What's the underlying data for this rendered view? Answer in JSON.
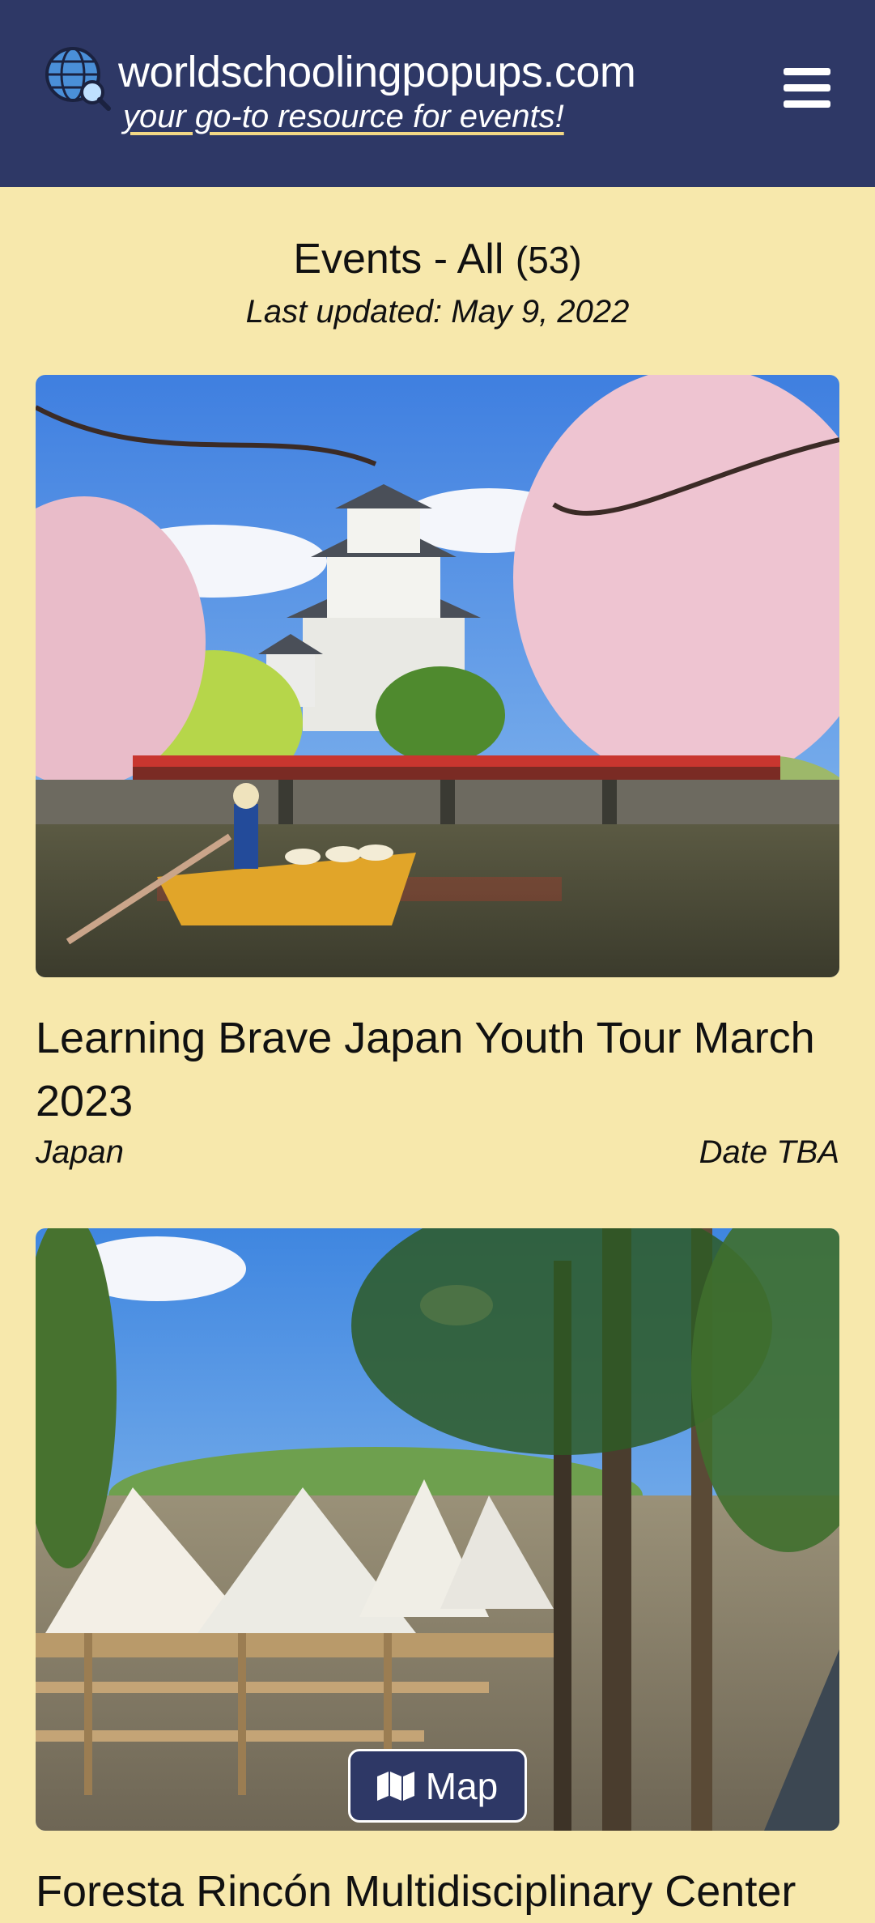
{
  "header": {
    "site_name": "worldschoolingpopups.com",
    "tagline": "your go-to resource for events!",
    "logo_icon": "globe-magnifier-icon",
    "menu_icon": "hamburger-menu-icon",
    "background_color": "#2e3866"
  },
  "page": {
    "title": "Events - All",
    "count": "(53)",
    "last_updated": "Last updated: May 9, 2022",
    "background_color": "#f7e8ac"
  },
  "events": [
    {
      "title": "Learning Brave Japan Youth Tour March 2023",
      "location": "Japan",
      "date": "Date TBA",
      "image": "Japanese castle with cherry blossoms and boat on moat"
    },
    {
      "title": "Foresta Rincón Multidisciplinary Center",
      "image": "White glamping tents with wooden decks among trees"
    }
  ],
  "map_button": {
    "label": "Map",
    "icon": "map-icon"
  }
}
